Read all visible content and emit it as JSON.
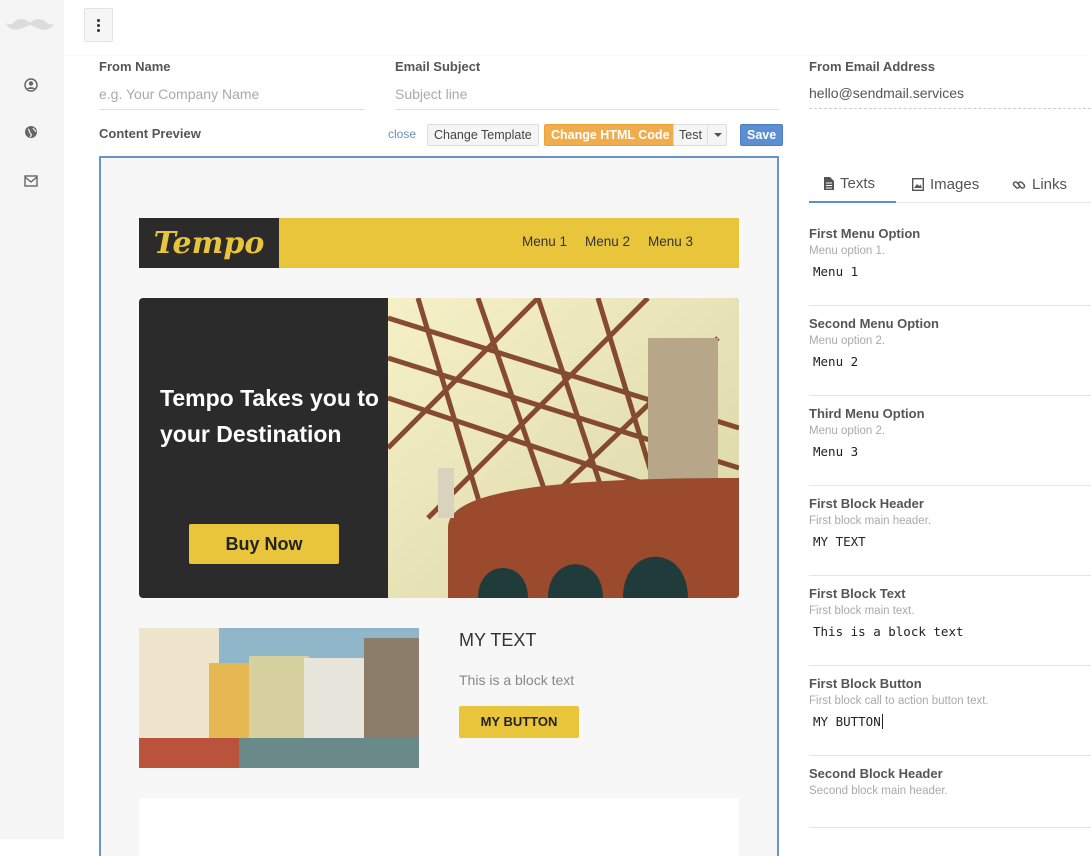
{
  "app": {
    "logo": "mustache-icon"
  },
  "sidebar": {
    "icons": [
      "user-circle-icon",
      "globe-icon",
      "envelope-icon"
    ]
  },
  "topbar": {
    "menu_icon": "kebab-menu-icon"
  },
  "form": {
    "from_name": {
      "label": "From Name",
      "placeholder": "e.g. Your Company Name"
    },
    "email_subject": {
      "label": "Email Subject",
      "placeholder": "Subject line"
    },
    "from_email": {
      "label": "From Email Address",
      "value": "hello@sendmail.services"
    }
  },
  "toolbar": {
    "section_label": "Content Preview",
    "close": "close",
    "change_template": "Change Template",
    "change_html": "Change HTML Code",
    "test": "Test",
    "save": "Save",
    "colors": {
      "orange": "#f0ad4e",
      "blue": "#5b8fd1"
    }
  },
  "preview": {
    "brand": "Tempo",
    "menu": [
      "Menu 1",
      "Menu 2",
      "Menu 3"
    ],
    "hero_title": "Tempo Takes you to your Destination",
    "hero_button": "Buy Now",
    "block_header": "MY TEXT",
    "block_text": "This is a block text",
    "block_button": "MY BUTTON",
    "accent": "#e8c53a"
  },
  "panel": {
    "tabs": [
      {
        "label": "Texts",
        "icon": "file-text-icon",
        "active": true
      },
      {
        "label": "Images",
        "icon": "image-icon",
        "active": false
      },
      {
        "label": "Links",
        "icon": "link-icon",
        "active": false
      }
    ],
    "options": [
      {
        "label": "First Menu Option",
        "desc": "Menu option 1.",
        "value": "Menu 1"
      },
      {
        "label": "Second Menu Option",
        "desc": "Menu option 2.",
        "value": "Menu 2"
      },
      {
        "label": "Third Menu Option",
        "desc": "Menu option 2.",
        "value": "Menu 3"
      },
      {
        "label": "First Block Header",
        "desc": "First block main header.",
        "value": "MY TEXT"
      },
      {
        "label": "First Block Text",
        "desc": "First block main text.",
        "value": "This is a block text"
      },
      {
        "label": "First Block Button",
        "desc": "First block call to action button text.",
        "value": "MY BUTTON"
      },
      {
        "label": "Second Block Header",
        "desc": "Second block main header.",
        "value": ""
      }
    ]
  }
}
